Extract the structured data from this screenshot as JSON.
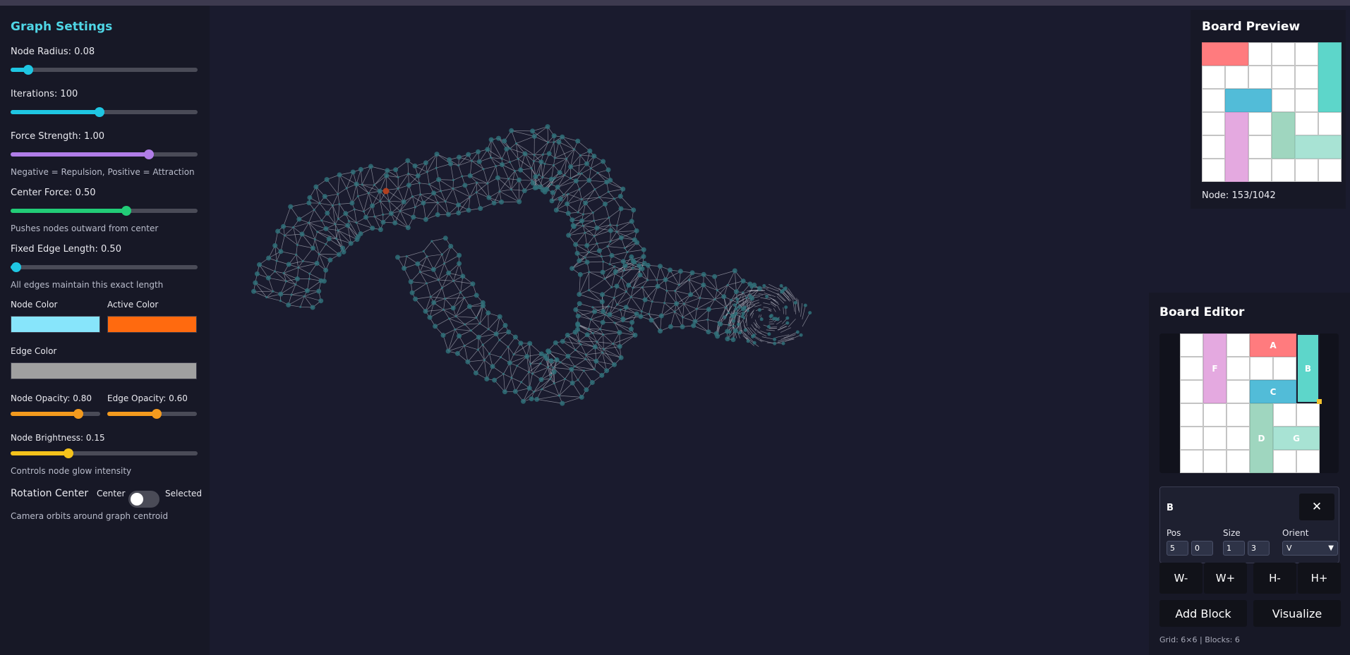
{
  "settings": {
    "title": "Graph Settings",
    "node_radius": {
      "label": "Node Radius: 0.08",
      "value": 0.08
    },
    "iterations": {
      "label": "Iterations: 100",
      "value": 100
    },
    "force_strength": {
      "label": "Force Strength: 1.00",
      "value": 1.0,
      "hint": "Negative = Repulsion, Positive = Attraction"
    },
    "center_force": {
      "label": "Center Force: 0.50",
      "value": 0.5,
      "hint": "Pushes nodes outward from center"
    },
    "fixed_edge_length": {
      "label": "Fixed Edge Length: 0.50",
      "value": 0.5,
      "hint": "All edges maintain this exact length"
    },
    "node_color": {
      "label": "Node Color",
      "value": "#87e5fb"
    },
    "active_color": {
      "label": "Active Color",
      "value": "#ff6a0f"
    },
    "edge_color": {
      "label": "Edge Color",
      "value": "#a0a0a0"
    },
    "node_opacity": {
      "label": "Node Opacity: 0.80",
      "value": 0.8
    },
    "edge_opacity": {
      "label": "Edge Opacity: 0.60",
      "value": 0.6
    },
    "node_brightness": {
      "label": "Node Brightness: 0.15",
      "value": 0.15,
      "hint": "Controls node glow intensity"
    },
    "rotation_center": {
      "label": "Rotation Center",
      "left_option": "Center",
      "right_option": "Selected",
      "selected": "Center",
      "hint": "Camera orbits around graph centroid"
    }
  },
  "colors": {
    "accent_cyan": "#1fc6e2",
    "accent_purple": "#b07de8",
    "accent_green": "#22cc77",
    "accent_orange": "#f39a1e",
    "accent_yellow": "#f4c21b",
    "graph_node": "#2f6f78",
    "graph_edge": "#c9ccd6",
    "selected_node": "#b04020"
  },
  "preview": {
    "title": "Board Preview",
    "node_label": "Node: 153/1042"
  },
  "board": {
    "cols": 6,
    "rows": 6,
    "blocks": [
      {
        "name": "A",
        "col": 3,
        "row": 0,
        "w": 2,
        "h": 1,
        "color": "#ff7b7e"
      },
      {
        "name": "B",
        "col": 5,
        "row": 0,
        "w": 1,
        "h": 3,
        "color": "#5dd6ca"
      },
      {
        "name": "C",
        "col": 3,
        "row": 2,
        "w": 2,
        "h": 1,
        "color": "#52bcd8"
      },
      {
        "name": "D",
        "col": 3,
        "row": 3,
        "w": 1,
        "h": 3,
        "color": "#9fd6bf"
      },
      {
        "name": "F",
        "col": 1,
        "row": 0,
        "w": 1,
        "h": 3,
        "color": "#e4a9e0"
      },
      {
        "name": "G",
        "col": 4,
        "row": 4,
        "w": 2,
        "h": 1,
        "color": "#a8e3d4"
      }
    ],
    "preview_blocks": [
      {
        "col": 0,
        "row": 0,
        "w": 2,
        "h": 1,
        "color": "#ff7b7e"
      },
      {
        "col": 5,
        "row": 0,
        "w": 1,
        "h": 3,
        "color": "#5dd6ca"
      },
      {
        "col": 1,
        "row": 2,
        "w": 2,
        "h": 1,
        "color": "#52bcd8"
      },
      {
        "col": 1,
        "row": 3,
        "w": 1,
        "h": 3,
        "color": "#e4a9e0"
      },
      {
        "col": 3,
        "row": 3,
        "w": 1,
        "h": 2,
        "color": "#9fd6bf"
      },
      {
        "col": 4,
        "row": 4,
        "w": 2,
        "h": 1,
        "color": "#a8e3d4"
      }
    ]
  },
  "editor": {
    "title": "Board Editor",
    "selected_block": "B",
    "close_symbol": "✕",
    "pos_label": "Pos",
    "pos_x": "5",
    "pos_y": "0",
    "size_label": "Size",
    "size_w": "1",
    "size_h": "3",
    "orient_label": "Orient",
    "orient_value": "V",
    "btn_w_minus": "W-",
    "btn_w_plus": "W+",
    "btn_h_minus": "H-",
    "btn_h_plus": "H+",
    "add_block": "Add Block",
    "visualize": "Visualize",
    "status": "Grid: 6×6 | Blocks: 6"
  }
}
